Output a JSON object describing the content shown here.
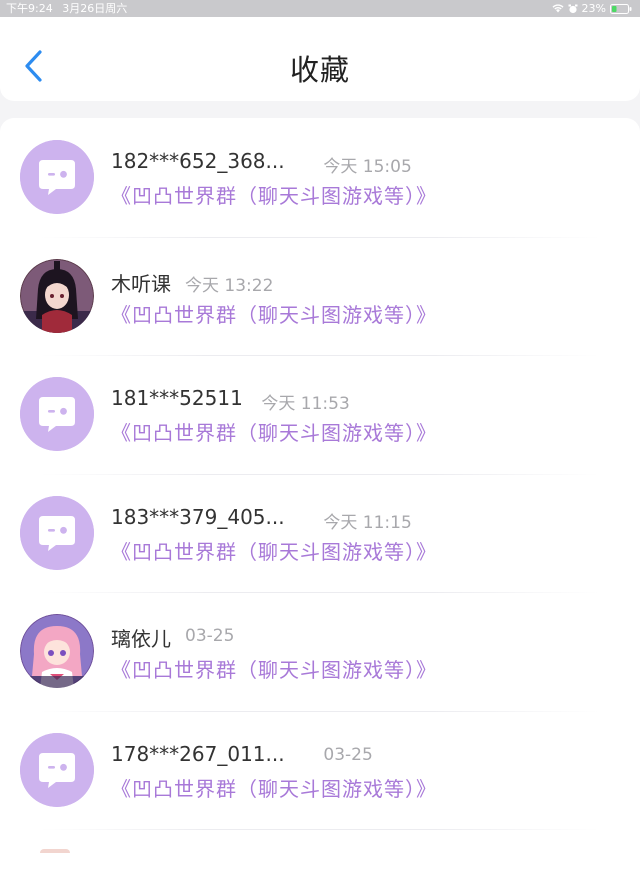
{
  "status_bar": {
    "time": "下午9:24",
    "date": "3月26日周六",
    "battery": "23%"
  },
  "header": {
    "title": "收藏",
    "back_icon": "chevron-left-icon"
  },
  "colors": {
    "accent": "#a879d8",
    "back_arrow": "#2d8cf0",
    "avatar_default": "#cdb3ee"
  },
  "favorites": [
    {
      "name": "182***652_368...",
      "time": "今天 15:05",
      "group": "《凹凸世界群（聊天斗图游戏等）》",
      "avatar": "default-chat-avatar"
    },
    {
      "name": "木听课",
      "time": "今天 13:22",
      "group": "《凹凸世界群（聊天斗图游戏等）》",
      "avatar": "anime-character-avatar"
    },
    {
      "name": "181***52511",
      "time": "今天 11:53",
      "group": "《凹凸世界群（聊天斗图游戏等）》",
      "avatar": "default-chat-avatar"
    },
    {
      "name": "183***379_405...",
      "time": "今天 11:15",
      "group": "《凹凸世界群（聊天斗图游戏等）》",
      "avatar": "default-chat-avatar"
    },
    {
      "name": "璃依儿",
      "time": "03-25",
      "group": "《凹凸世界群（聊天斗图游戏等）》",
      "avatar": "anime-girl-avatar"
    },
    {
      "name": "178***267_011...",
      "time": "03-25",
      "group": "《凹凸世界群（聊天斗图游戏等）》",
      "avatar": "default-chat-avatar"
    }
  ]
}
